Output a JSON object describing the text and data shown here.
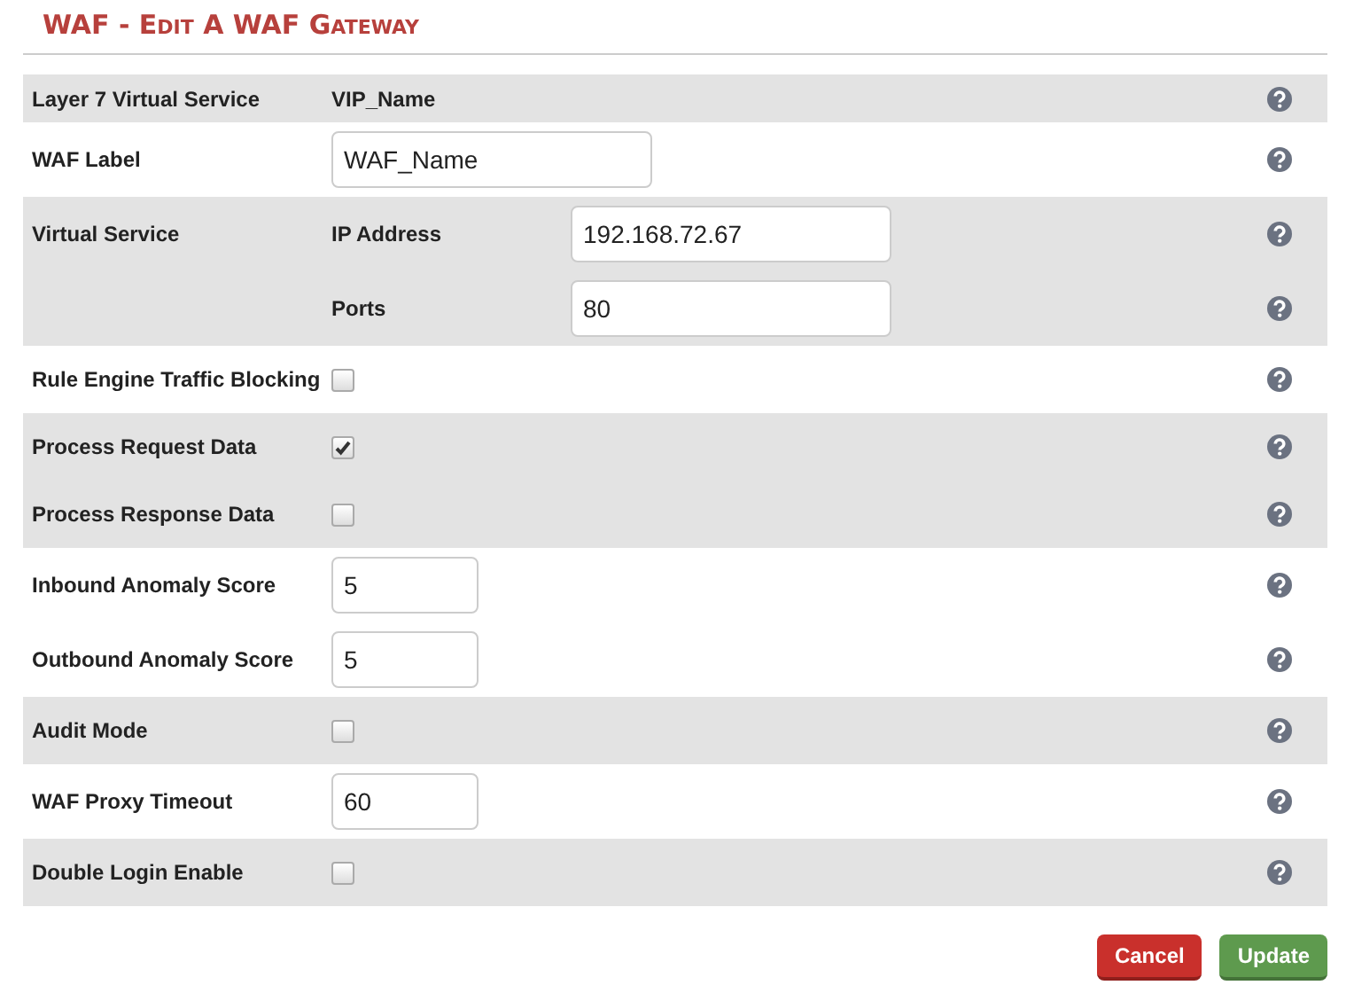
{
  "title": "WAF - Edit A WAF Gateway",
  "rows": [
    {
      "label": "Layer 7 Virtual Service",
      "shaded": true,
      "fields": [
        {
          "kind": "text",
          "value": "VIP_Name"
        }
      ]
    },
    {
      "label": "WAF Label",
      "shaded": false,
      "fields": [
        {
          "kind": "text-input",
          "value": "WAF_Name"
        }
      ]
    },
    {
      "label": "Virtual Service",
      "shaded": true,
      "fields": [
        {
          "sublabel": "IP Address",
          "kind": "text-input",
          "value": "192.168.72.67"
        },
        {
          "sublabel": "Ports",
          "kind": "text-input",
          "value": "80"
        }
      ]
    },
    {
      "label": "Rule Engine Traffic Blocking",
      "shaded": false,
      "fields": [
        {
          "kind": "checkbox",
          "checked": false
        }
      ]
    },
    {
      "label": "Process Request Data",
      "shaded": true,
      "fields": [
        {
          "kind": "checkbox",
          "checked": true
        }
      ]
    },
    {
      "label": "Process Response Data",
      "shaded": true,
      "fields": [
        {
          "kind": "checkbox",
          "checked": false
        }
      ]
    },
    {
      "label": "Inbound Anomaly Score",
      "shaded": false,
      "fields": [
        {
          "kind": "number-input",
          "value": "5"
        }
      ]
    },
    {
      "label": "Outbound Anomaly Score",
      "shaded": false,
      "fields": [
        {
          "kind": "number-input",
          "value": "5"
        }
      ]
    },
    {
      "label": "Audit Mode",
      "shaded": true,
      "fields": [
        {
          "kind": "checkbox",
          "checked": false
        }
      ]
    },
    {
      "label": "WAF Proxy Timeout",
      "shaded": false,
      "fields": [
        {
          "kind": "number-input",
          "value": "60"
        }
      ]
    },
    {
      "label": "Double Login Enable",
      "shaded": true,
      "fields": [
        {
          "kind": "checkbox",
          "checked": false
        }
      ]
    }
  ],
  "buttons": [
    {
      "label": "Cancel",
      "kind": "cancel"
    },
    {
      "label": "Update",
      "kind": "update"
    }
  ]
}
